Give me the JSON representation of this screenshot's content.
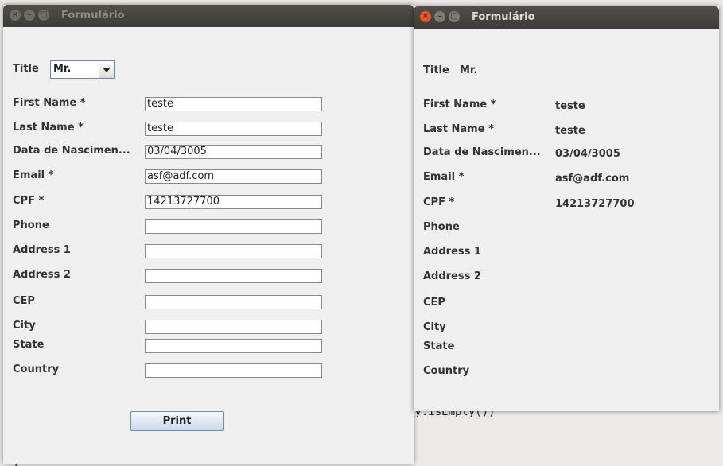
{
  "background": {
    "code_snippet": "ry.isEmpty())",
    "code_brace": "}"
  },
  "form_window": {
    "title": "Formulário",
    "title_label": "Title",
    "title_value": "Mr.",
    "fields": [
      {
        "label": "First Name *",
        "value": "teste"
      },
      {
        "label": "Last Name *",
        "value": "teste"
      },
      {
        "label": "Data de Nascimen...",
        "value": "03/04/3005"
      },
      {
        "label": "Email *",
        "value": "asf@adf.com"
      },
      {
        "label": "CPF *",
        "value": "14213727700"
      },
      {
        "label": "Phone",
        "value": ""
      },
      {
        "label": "Address 1",
        "value": ""
      },
      {
        "label": "Address 2",
        "value": ""
      },
      {
        "label": "CEP",
        "value": ""
      },
      {
        "label": "City",
        "value": ""
      },
      {
        "label": "State",
        "value": ""
      },
      {
        "label": "Country",
        "value": ""
      }
    ],
    "print_button": "Print"
  },
  "result_window": {
    "title": "Formulário",
    "title_label": "Title",
    "title_value": "Mr.",
    "fields": [
      {
        "label": "First Name *",
        "value": "teste"
      },
      {
        "label": "Last Name *",
        "value": "teste"
      },
      {
        "label": "Data de Nascimen...",
        "value": "03/04/3005"
      },
      {
        "label": "Email *",
        "value": "asf@adf.com"
      },
      {
        "label": "CPF *",
        "value": "14213727700"
      },
      {
        "label": "Phone",
        "value": ""
      },
      {
        "label": "Address 1",
        "value": ""
      },
      {
        "label": "Address 2",
        "value": ""
      },
      {
        "label": "CEP",
        "value": ""
      },
      {
        "label": "City",
        "value": ""
      },
      {
        "label": "State",
        "value": ""
      },
      {
        "label": "Country",
        "value": ""
      }
    ]
  },
  "colors": {
    "titlebar": "#3c3b37",
    "close_button_active": "#e9542a",
    "window_bg": "#efefef"
  },
  "icons": {
    "close": "close-icon",
    "minimize": "minimize-icon",
    "maximize": "maximize-icon",
    "dropdown": "chevron-down-icon"
  }
}
